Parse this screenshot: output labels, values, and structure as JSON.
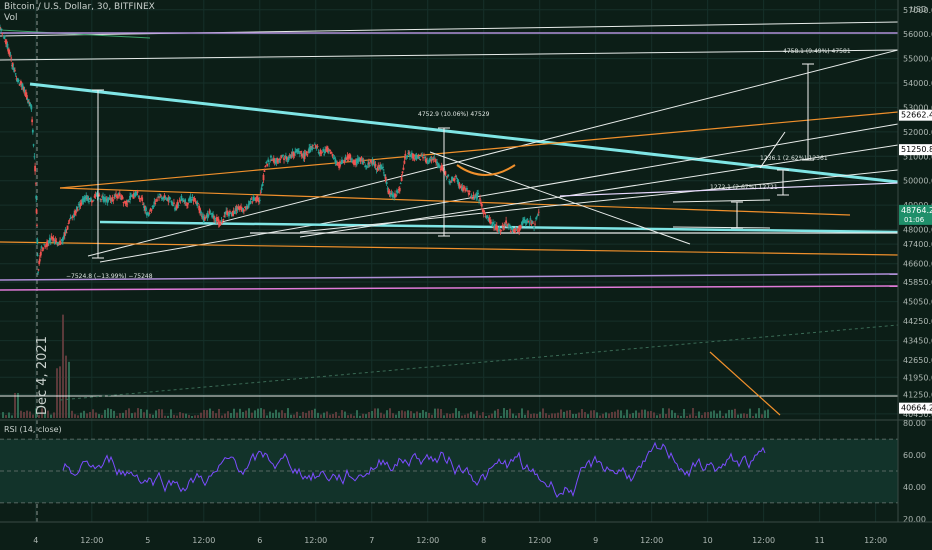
{
  "header": {
    "symbol": "Bitcoin / U.S. Dollar, 30, BITFINEX",
    "volume_label": "Vol",
    "currency": "USD"
  },
  "rsi_pane": {
    "label": "RSI (14, close)",
    "levels": [
      80.0,
      60.0,
      40.0,
      20.0
    ],
    "ylim": [
      18,
      82
    ],
    "upper_band": 70,
    "lower_band": 30,
    "mid_band": 50
  },
  "annotations": {
    "date_label": "Dec 4, 2021",
    "range_left": "−7524.8 (−13.99%) −75248",
    "range_mid": "4752.9 (10.06%) 47529",
    "range_right": "4758.1 (9.49%) 47581",
    "range_small1": "1272.1 (2.67%) 12721",
    "range_small2": "1236.1 (2.62%) 12361"
  },
  "price_tags": [
    {
      "value": "52662.4",
      "color": "#ffffff",
      "text_color": "#000000"
    },
    {
      "value": "51250.8",
      "color": "#ffffff",
      "text_color": "#000000"
    },
    {
      "value": "48764.2",
      "color": "#1f8f6a",
      "text_color": "#ffffff",
      "sub": "01:06"
    },
    {
      "value": "40664.2",
      "color": "#ffffff",
      "text_color": "#000000"
    }
  ],
  "chart_data": {
    "type": "line",
    "title": "Bitcoin / U.S. Dollar, 30, BITFINEX",
    "ylabel": "USD",
    "ylim": [
      40200,
      57400
    ],
    "y_ticks": [
      57000,
      56000,
      55000,
      54000,
      53000,
      52000,
      51000,
      50000,
      49000,
      48000,
      47400,
      46600,
      45850,
      45050,
      44250,
      43450,
      42650,
      41950,
      41250,
      40450
    ],
    "x_tick_labels": [
      "4",
      "12:00",
      "5",
      "12:00",
      "6",
      "12:00",
      "7",
      "12:00",
      "8",
      "12:00",
      "9",
      "12:00",
      "10",
      "12:00",
      "11",
      "12:00"
    ],
    "x_tick_pos": [
      0.5,
      1.0,
      1.5,
      2.0,
      2.5,
      3.0,
      3.5,
      4.0,
      4.5,
      5.0,
      5.5,
      6.0,
      6.5,
      7.0,
      7.5,
      8.0
    ],
    "xlim": [
      0.18,
      8.2
    ],
    "series": [
      {
        "points": [
          [
            0.18,
            56200
          ],
          [
            0.22,
            55900
          ],
          [
            0.26,
            55300
          ],
          [
            0.3,
            54600
          ],
          [
            0.34,
            54100
          ],
          [
            0.38,
            53900
          ],
          [
            0.42,
            53400
          ],
          [
            0.46,
            53000
          ],
          [
            0.5,
            50000
          ],
          [
            0.52,
            46300
          ],
          [
            0.55,
            47200
          ],
          [
            0.6,
            47400
          ],
          [
            0.65,
            47700
          ],
          [
            0.7,
            47300
          ],
          [
            0.75,
            47700
          ],
          [
            0.8,
            48300
          ],
          [
            0.85,
            48700
          ],
          [
            0.9,
            49100
          ],
          [
            0.95,
            49300
          ],
          [
            1.0,
            49200
          ],
          [
            1.05,
            49400
          ],
          [
            1.1,
            49300
          ],
          [
            1.15,
            49200
          ],
          [
            1.2,
            49300
          ],
          [
            1.25,
            49400
          ],
          [
            1.3,
            49100
          ],
          [
            1.35,
            49300
          ],
          [
            1.4,
            49500
          ],
          [
            1.45,
            49200
          ],
          [
            1.5,
            48600
          ],
          [
            1.55,
            49000
          ],
          [
            1.6,
            49400
          ],
          [
            1.65,
            49300
          ],
          [
            1.7,
            49200
          ],
          [
            1.75,
            48900
          ],
          [
            1.8,
            49300
          ],
          [
            1.85,
            49100
          ],
          [
            1.9,
            49300
          ],
          [
            1.95,
            49000
          ],
          [
            2.0,
            48400
          ],
          [
            2.05,
            48700
          ],
          [
            2.1,
            48500
          ],
          [
            2.15,
            48200
          ],
          [
            2.2,
            48700
          ],
          [
            2.25,
            48600
          ],
          [
            2.3,
            48900
          ],
          [
            2.35,
            48800
          ],
          [
            2.4,
            49000
          ],
          [
            2.45,
            49300
          ],
          [
            2.5,
            49200
          ],
          [
            2.55,
            50600
          ],
          [
            2.6,
            50900
          ],
          [
            2.65,
            50800
          ],
          [
            2.7,
            51000
          ],
          [
            2.75,
            50900
          ],
          [
            2.8,
            51100
          ],
          [
            2.85,
            51200
          ],
          [
            2.9,
            51000
          ],
          [
            2.95,
            51300
          ],
          [
            3.0,
            51400
          ],
          [
            3.05,
            51100
          ],
          [
            3.1,
            51300
          ],
          [
            3.15,
            51000
          ],
          [
            3.2,
            50600
          ],
          [
            3.25,
            50800
          ],
          [
            3.3,
            51000
          ],
          [
            3.35,
            50700
          ],
          [
            3.4,
            50900
          ],
          [
            3.45,
            50600
          ],
          [
            3.5,
            50800
          ],
          [
            3.55,
            50500
          ],
          [
            3.6,
            50600
          ],
          [
            3.65,
            49500
          ],
          [
            3.7,
            49400
          ],
          [
            3.75,
            49600
          ],
          [
            3.8,
            51000
          ],
          [
            3.85,
            51100
          ],
          [
            3.9,
            50900
          ],
          [
            3.95,
            51000
          ],
          [
            4.0,
            50800
          ],
          [
            4.05,
            50900
          ],
          [
            4.1,
            50600
          ],
          [
            4.15,
            50400
          ],
          [
            4.2,
            50000
          ],
          [
            4.25,
            50100
          ],
          [
            4.3,
            49700
          ],
          [
            4.35,
            49600
          ],
          [
            4.4,
            49300
          ],
          [
            4.45,
            49400
          ],
          [
            4.5,
            48700
          ],
          [
            4.55,
            48400
          ],
          [
            4.6,
            48100
          ],
          [
            4.65,
            48000
          ],
          [
            4.7,
            48300
          ],
          [
            4.75,
            48000
          ],
          [
            4.8,
            47900
          ],
          [
            4.85,
            48300
          ],
          [
            4.9,
            48400
          ],
          [
            4.95,
            48200
          ],
          [
            5.0,
            48700
          ]
        ]
      }
    ]
  }
}
